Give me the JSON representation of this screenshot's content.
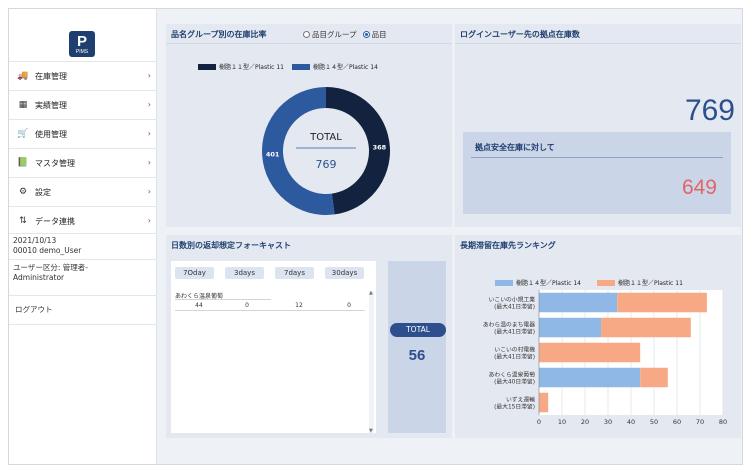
{
  "logo": {
    "letter": "P",
    "sub": "PIMS"
  },
  "nav": [
    {
      "id": "inventory",
      "icon": "truck-icon",
      "glyph": "🚚",
      "label": "在庫管理"
    },
    {
      "id": "results",
      "icon": "grid-icon",
      "glyph": "▦",
      "label": "実績管理"
    },
    {
      "id": "usage",
      "icon": "cart-icon",
      "glyph": "🛒",
      "label": "使用管理"
    },
    {
      "id": "master",
      "icon": "book-icon",
      "glyph": "📗",
      "label": "マスタ管理"
    },
    {
      "id": "settings",
      "icon": "gear-icon",
      "glyph": "⚙",
      "label": "設定"
    },
    {
      "id": "data-link",
      "icon": "swap-icon",
      "glyph": "⇅",
      "label": "データ連携"
    }
  ],
  "user": {
    "date": "2021/10/13",
    "user": "00010 demo_User",
    "role_line1": "ユーザー区分: 管理者-",
    "role_line2": "Administrator",
    "logout": "ログアウト"
  },
  "ratio_panel": {
    "title": "品名グループ別の在庫比率",
    "radio_group": "品目グループ",
    "radio_item": "品目",
    "center_label": "TOTAL",
    "center_value": "769",
    "colors": {
      "s1": "#13223f",
      "s2": "#2d5a9e"
    }
  },
  "stock_panel": {
    "title": "ログインユーザー先の拠点在庫数",
    "value": "769",
    "box_title": "拠点安全在庫に対して",
    "box_value": "649"
  },
  "forecast_panel": {
    "title": "日数別の返却想定フォーキャスト",
    "tabs": [
      "7Oday",
      "3days",
      "7days",
      "30days"
    ],
    "group": "あわくら温泉葡萄",
    "row": [
      "44",
      "0",
      "12",
      "0"
    ],
    "total_label": "TOTAL",
    "total_value": "56"
  },
  "chart_data": [
    {
      "type": "pie",
      "series": [
        {
          "name": "樹脂１１型／Plastic 11",
          "value": 368,
          "color": "#13223f"
        },
        {
          "name": "樹脂１４型／Plastic 14",
          "value": 401,
          "color": "#2d5a9e"
        }
      ],
      "title": "品名グループ別の在庫比率",
      "legend": "top"
    },
    {
      "type": "bar",
      "orientation": "horizontal",
      "stacked": true,
      "title": "長期滞留在庫先ランキング",
      "categories": [
        [
          "いこいの小規工業",
          "(最大41日滞留)"
        ],
        [
          "あわら温のまち電器",
          "(最大41日滞留)"
        ],
        [
          "いこいの村電機",
          "(最大41日滞留)"
        ],
        [
          "あわくら温泉葡萄",
          "(最大40日滞留)"
        ],
        [
          "いずえ運輸",
          "(最大15日滞留)"
        ]
      ],
      "series": [
        {
          "name": "樹脂１４型／Plastic 14",
          "values": [
            34,
            27,
            0,
            44,
            0
          ],
          "color": "#8fb8e6"
        },
        {
          "name": "樹脂１１型／Plastic 11",
          "values": [
            39,
            39,
            44,
            12,
            4
          ],
          "color": "#f7a884"
        }
      ],
      "xlim": [
        0,
        80
      ],
      "xticks": [
        0,
        10,
        20,
        30,
        40,
        50,
        60,
        70,
        80
      ],
      "grid": true,
      "legend": "top"
    }
  ]
}
